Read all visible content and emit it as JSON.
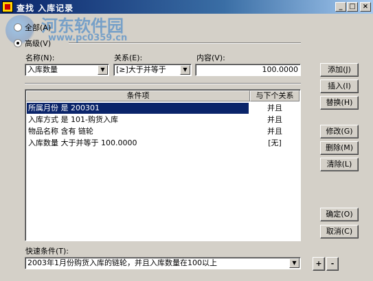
{
  "window": {
    "title": "查找  入库记录",
    "watermark_line1": "河东软件园",
    "watermark_line2": "www.pc0359.cn"
  },
  "mode": {
    "all_label": "全部(A)",
    "advanced_label": "高级(V)",
    "selected": "advanced"
  },
  "fields": {
    "name_label": "名称(N):",
    "name_value": "入库数量",
    "relation_label": "关系(E):",
    "relation_value": "[≥]大于并等于",
    "content_label": "内容(V):",
    "content_value": "100.0000"
  },
  "table": {
    "col_condition": "条件项",
    "col_relation": "与下个关系",
    "rows": [
      {
        "condition": "所属月份  是  200301",
        "relation": "并且"
      },
      {
        "condition": "入库方式  是  101-购货入库",
        "relation": "并且"
      },
      {
        "condition": "物品名称  含有  链轮",
        "relation": "并且"
      },
      {
        "condition": "入库数量  大于并等于  100.0000",
        "relation": "[无]"
      }
    ]
  },
  "buttons": {
    "add": "添加(J)",
    "insert": "插入(I)",
    "replace": "替换(H)",
    "edit": "修改(G)",
    "delete": "删除(M)",
    "clear": "清除(L)",
    "ok": "确定(O)",
    "cancel": "取消(C)",
    "plus": "+",
    "minus": "-"
  },
  "quick": {
    "label": "快速条件(T):",
    "value": "2003年1月份购货入库的链轮，并且入库数量在100以上"
  },
  "window_controls": {
    "minimize": "_",
    "maximize": "□",
    "close": "×"
  }
}
